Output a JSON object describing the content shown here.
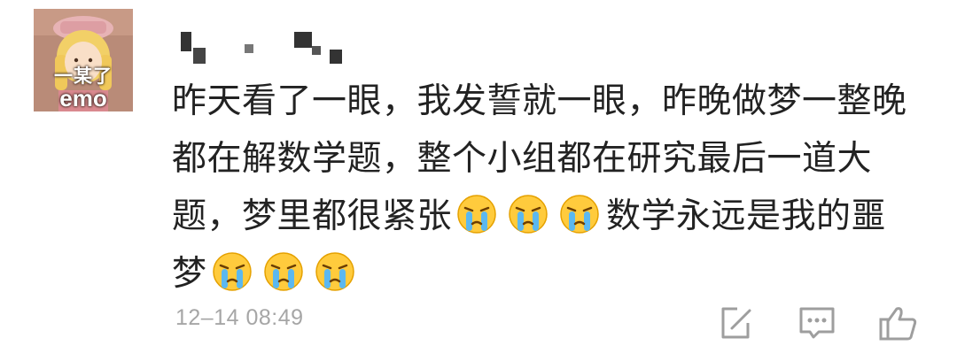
{
  "avatar": {
    "caption_line1": "一某了",
    "caption_line2": "emo"
  },
  "comment": {
    "username_redacted": true,
    "text_part1": "昨天看了一眼，我发誓就一眼，昨晚做梦一整晚都在解数学题，整个小组都在研究最后一道大题，梦里都很紧张",
    "text_part2": "数学永远是我的噩梦",
    "emoji_group1": [
      "crying-face",
      "crying-face",
      "crying-face"
    ],
    "emoji_group2": [
      "crying-face",
      "crying-face",
      "crying-face"
    ],
    "timestamp": "12–14 08:49"
  },
  "actions": {
    "icons": [
      "edit-icon",
      "comment-icon",
      "like-icon"
    ]
  },
  "colors": {
    "background": "#ffffff",
    "text": "#222222",
    "timestamp": "#a6a6a6",
    "icon": "#9e9e9e"
  }
}
